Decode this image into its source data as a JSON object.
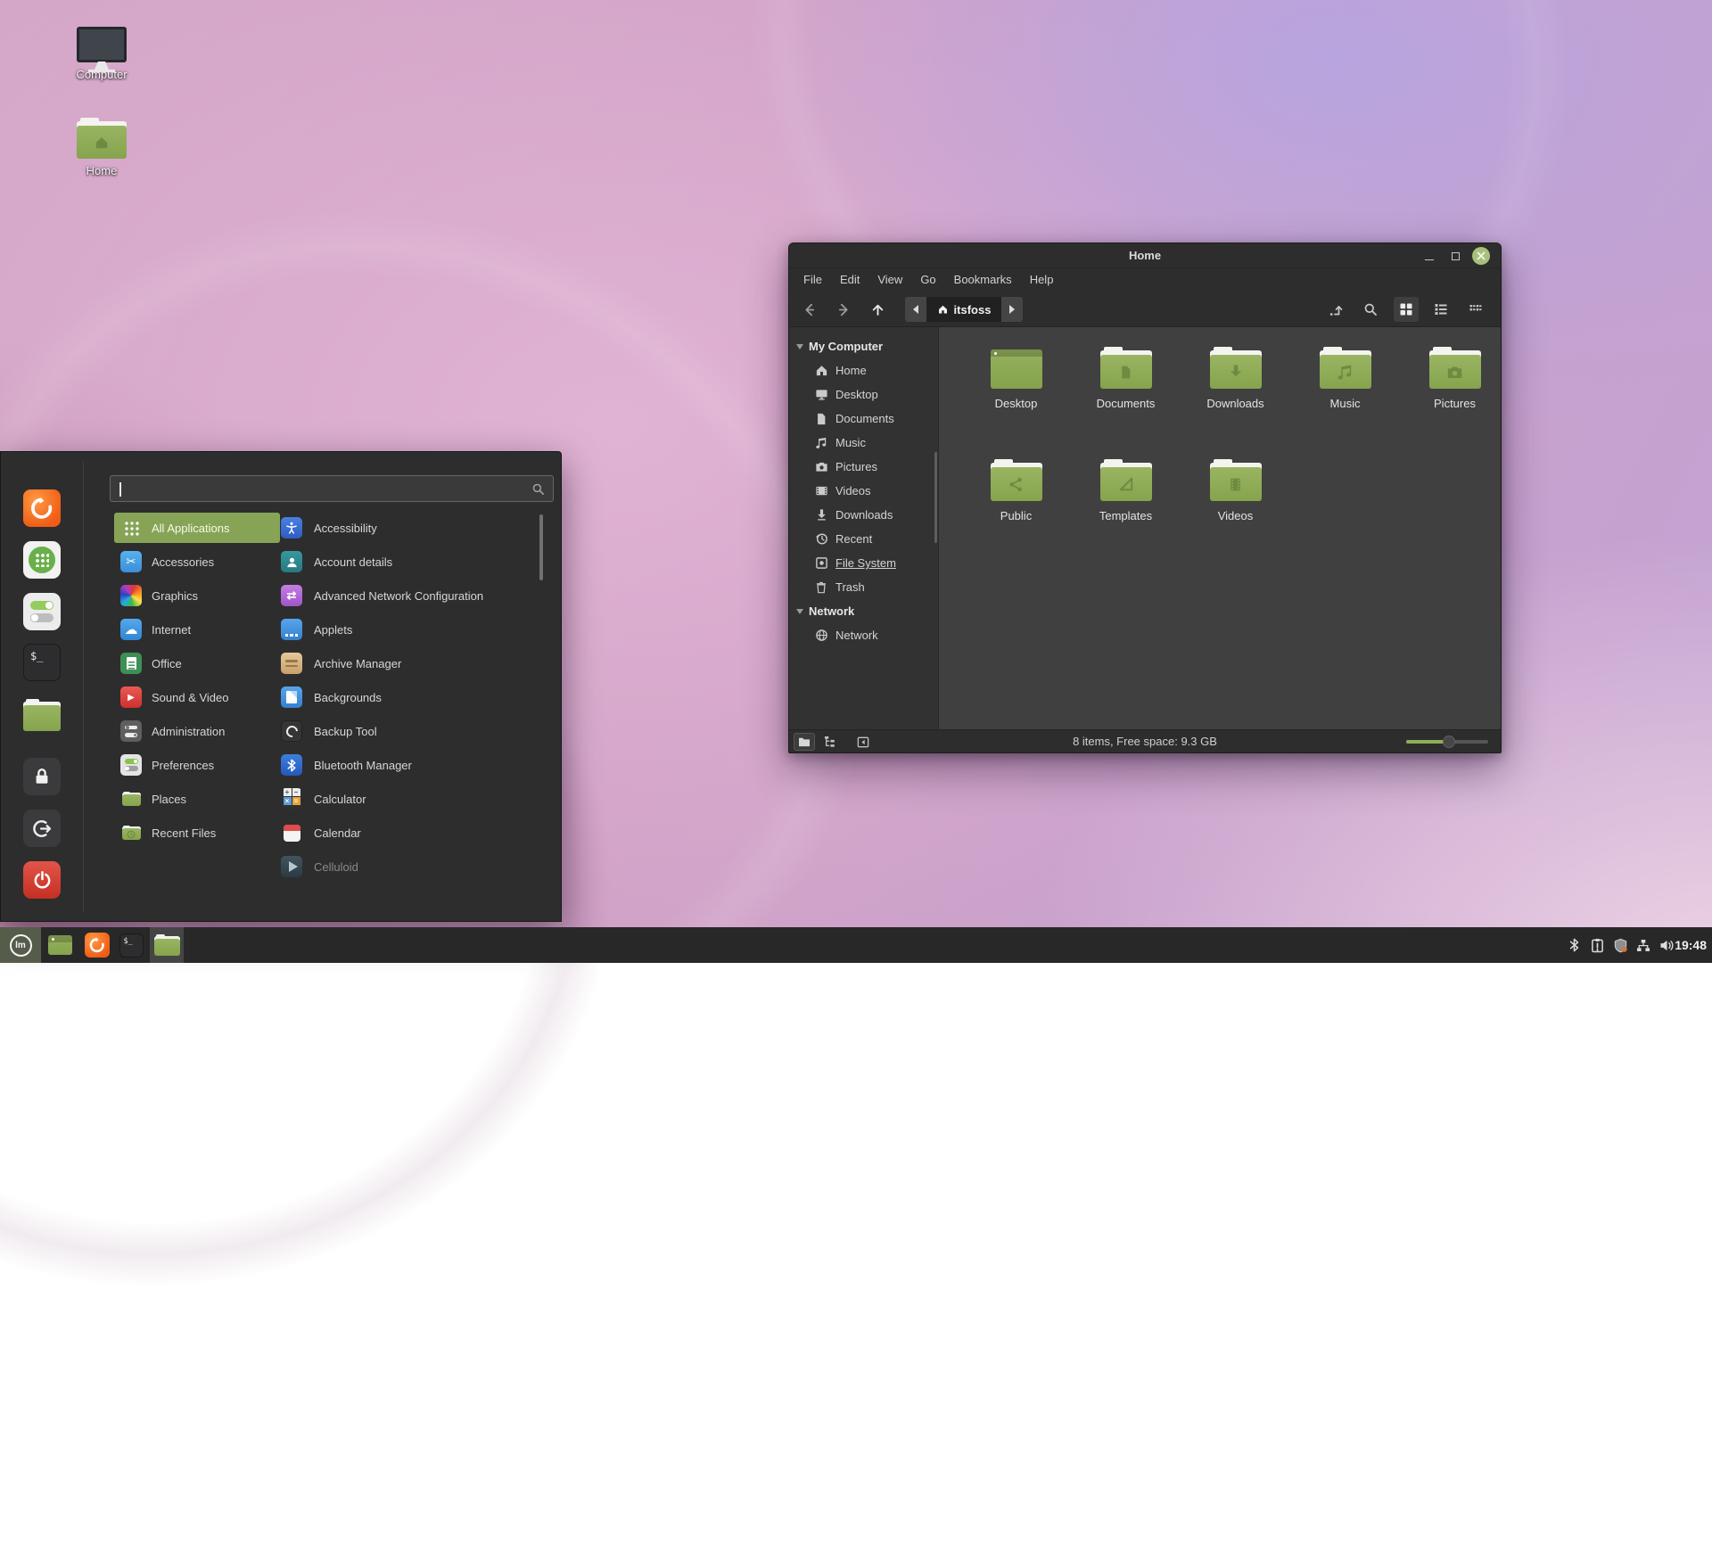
{
  "desktop": {
    "icons": [
      {
        "label": "Computer"
      },
      {
        "label": "Home"
      }
    ]
  },
  "window": {
    "title": "Home",
    "menubar": [
      {
        "label": "File"
      },
      {
        "label": "Edit"
      },
      {
        "label": "View"
      },
      {
        "label": "Go"
      },
      {
        "label": "Bookmarks"
      },
      {
        "label": "Help"
      }
    ],
    "toolbar": {
      "location": "itsfoss"
    },
    "sidebar": {
      "computer_header": "My Computer",
      "computer_items": [
        {
          "label": "Home"
        },
        {
          "label": "Desktop"
        },
        {
          "label": "Documents"
        },
        {
          "label": "Music"
        },
        {
          "label": "Pictures"
        },
        {
          "label": "Videos"
        },
        {
          "label": "Downloads"
        },
        {
          "label": "Recent"
        },
        {
          "label": "File System"
        },
        {
          "label": "Trash"
        }
      ],
      "network_header": "Network",
      "network_items": [
        {
          "label": "Network"
        }
      ]
    },
    "files": [
      {
        "label": "Desktop"
      },
      {
        "label": "Documents"
      },
      {
        "label": "Downloads"
      },
      {
        "label": "Music"
      },
      {
        "label": "Pictures"
      },
      {
        "label": "Public"
      },
      {
        "label": "Templates"
      },
      {
        "label": "Videos"
      }
    ],
    "statusbar": {
      "summary": "8 items, Free space: 9.3 GB"
    }
  },
  "menu": {
    "search_value": "",
    "categories": [
      {
        "label": "All Applications"
      },
      {
        "label": "Accessories"
      },
      {
        "label": "Graphics"
      },
      {
        "label": "Internet"
      },
      {
        "label": "Office"
      },
      {
        "label": "Sound & Video"
      },
      {
        "label": "Administration"
      },
      {
        "label": "Preferences"
      },
      {
        "label": "Places"
      },
      {
        "label": "Recent Files"
      }
    ],
    "apps": [
      {
        "label": "Accessibility"
      },
      {
        "label": "Account details"
      },
      {
        "label": "Advanced Network Configuration"
      },
      {
        "label": "Applets"
      },
      {
        "label": "Archive Manager"
      },
      {
        "label": "Backgrounds"
      },
      {
        "label": "Backup Tool"
      },
      {
        "label": "Bluetooth Manager"
      },
      {
        "label": "Calculator"
      },
      {
        "label": "Calendar"
      },
      {
        "label": "Celluloid"
      }
    ]
  },
  "taskbar": {
    "clock": "19:48"
  },
  "icons": {
    "mint_logo": "lm",
    "terminal_text": "$_",
    "music_note": "♪",
    "cloud": "☁",
    "scissors": "✂",
    "play": "▶",
    "swap_arrows": "⇄",
    "calc_plus": "+",
    "calc_minus": "−",
    "calc_times": "×",
    "calc_equals": "="
  },
  "colors": {
    "mint_green": "#8fae58",
    "selected_green": "#87a456",
    "close_button_green": "#a6c17c",
    "panel_bg": "#282828",
    "shutdown_red": "#d64040"
  }
}
